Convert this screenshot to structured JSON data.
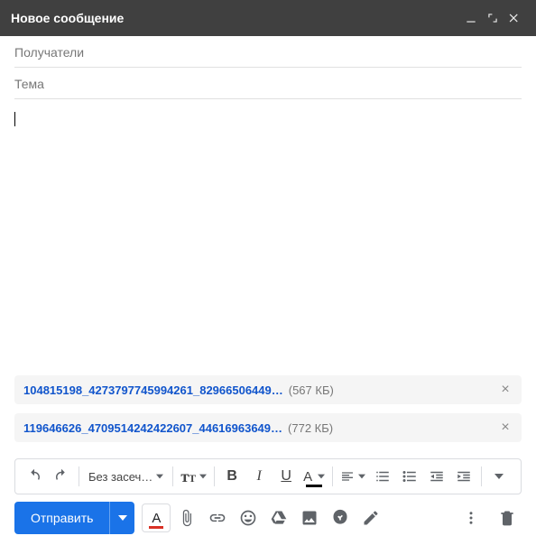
{
  "header": {
    "title": "Новое сообщение"
  },
  "fields": {
    "recipients_placeholder": "Получатели",
    "subject_placeholder": "Тема"
  },
  "body": {
    "text": ""
  },
  "attachments": [
    {
      "name": "104815198_4273797745994261_82966506449…",
      "size": "(567 КБ)"
    },
    {
      "name": "119646626_4709514242422607_44616963649…",
      "size": "(772 КБ)"
    }
  ],
  "format_toolbar": {
    "font_label": "Без засеч…"
  },
  "actions": {
    "send_label": "Отправить"
  }
}
